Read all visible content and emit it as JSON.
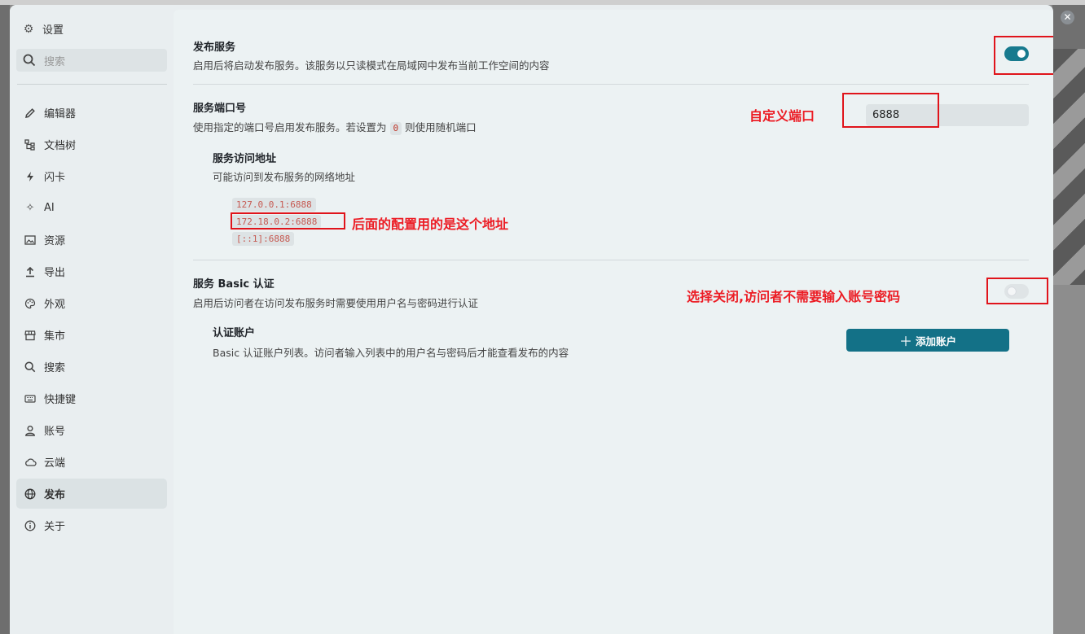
{
  "sidebar": {
    "title": "设置",
    "search_placeholder": "搜索",
    "items": [
      {
        "label": "编辑器",
        "icon": "pencil-icon"
      },
      {
        "label": "文档树",
        "icon": "tree-icon"
      },
      {
        "label": "闪卡",
        "icon": "flash-icon"
      },
      {
        "label": "AI",
        "icon": "sparkle-icon"
      },
      {
        "label": "资源",
        "icon": "image-icon"
      },
      {
        "label": "导出",
        "icon": "upload-icon"
      },
      {
        "label": "外观",
        "icon": "palette-icon"
      },
      {
        "label": "集市",
        "icon": "store-icon"
      },
      {
        "label": "搜索",
        "icon": "search-icon"
      },
      {
        "label": "快捷键",
        "icon": "keyboard-icon"
      },
      {
        "label": "账号",
        "icon": "user-icon"
      },
      {
        "label": "云端",
        "icon": "cloud-icon"
      },
      {
        "label": "发布",
        "icon": "globe-icon",
        "active": true
      },
      {
        "label": "关于",
        "icon": "info-icon"
      }
    ]
  },
  "publish": {
    "title": "发布服务",
    "desc": "启用后将启动发布服务。该服务以只读模式在局域网中发布当前工作空间的内容",
    "enabled": true
  },
  "port": {
    "title": "服务端口号",
    "desc_before": "使用指定的端口号启用发布服务。若设置为",
    "desc_code": "0",
    "desc_after": "则使用随机端口",
    "value": "6888"
  },
  "address": {
    "title": "服务访问地址",
    "desc": "可能访问到发布服务的网络地址",
    "items": [
      "127.0.0.1:6888",
      "172.18.0.2:6888",
      "[::1]:6888"
    ]
  },
  "basic_auth": {
    "title": "服务 Basic 认证",
    "desc": "启用后访问者在访问发布服务时需要使用用户名与密码进行认证",
    "enabled": false
  },
  "accounts": {
    "title": "认证账户",
    "desc": "Basic 认证账户列表。访问者输入列表中的用户名与密码后才能查看发布的内容",
    "add_label": "添加账户"
  },
  "annotations": {
    "port": "自定义端口",
    "address": "后面的配置用的是这个地址",
    "auth": "选择关闭,访问者不需要输入账号密码"
  },
  "colors": {
    "accent": "#137187",
    "annotation": "#ec1c24"
  }
}
